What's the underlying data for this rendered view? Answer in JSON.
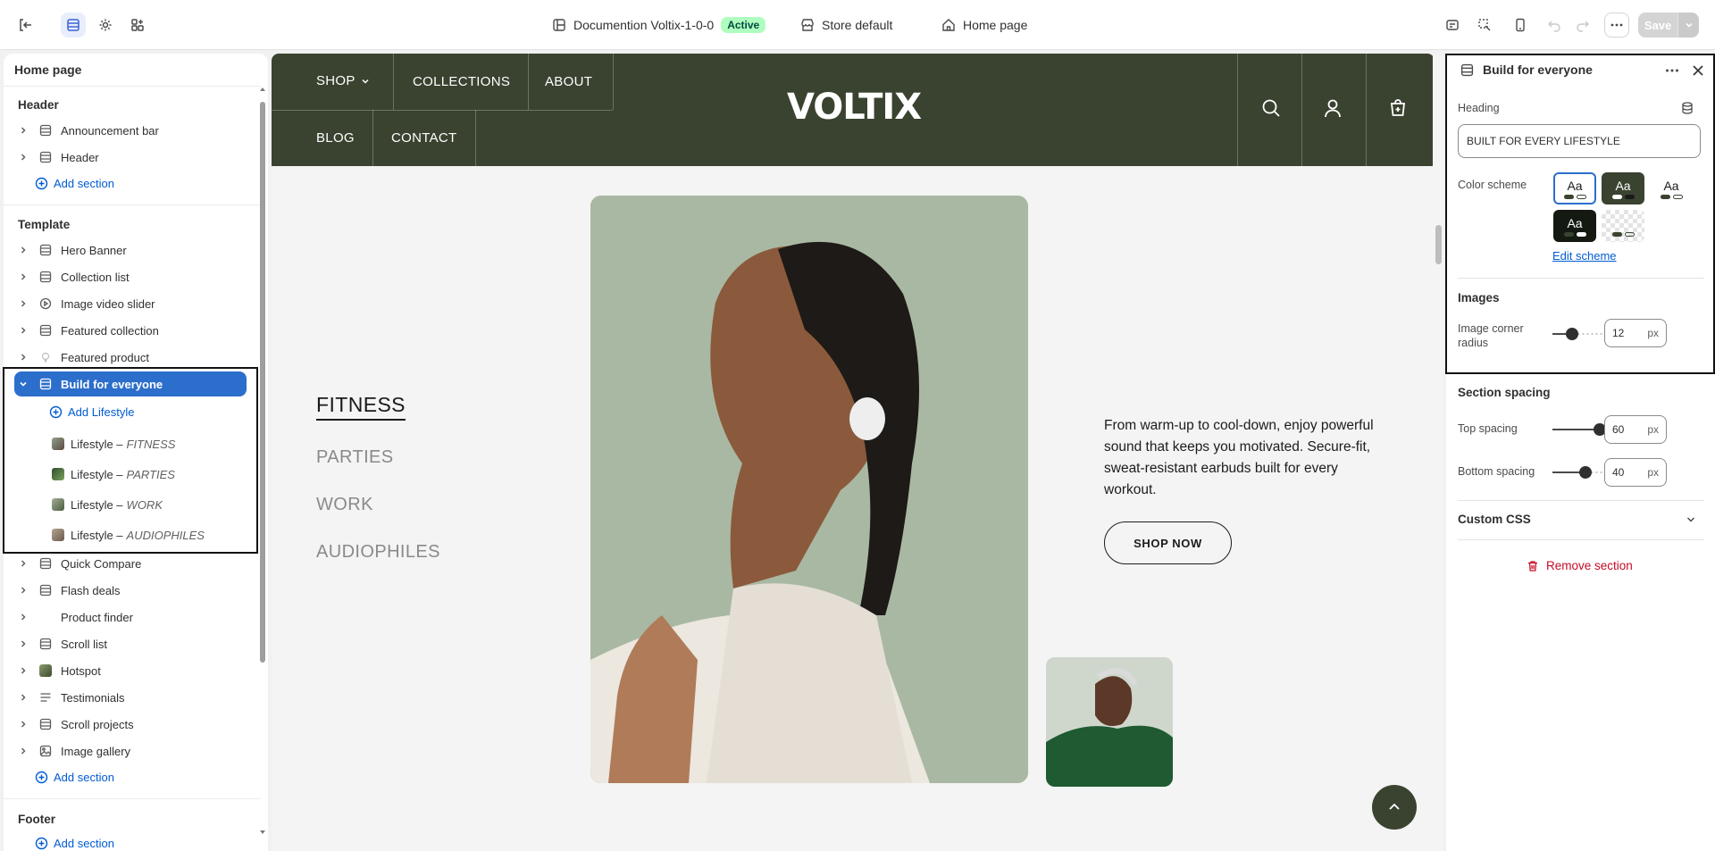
{
  "topbar": {
    "theme_name": "Documention Voltix-1-0-0",
    "status_badge": "Active",
    "store_context": "Store default",
    "page_selector": "Home page",
    "save_label": "Save"
  },
  "left_panel": {
    "title": "Home page",
    "header_group": {
      "label": "Header",
      "items": [
        {
          "label": "Announcement bar"
        },
        {
          "label": "Header"
        }
      ],
      "add_label": "Add section"
    },
    "template_group": {
      "label": "Template",
      "items_before": [
        {
          "label": "Hero Banner",
          "icon": "section-icon"
        },
        {
          "label": "Collection list",
          "icon": "section-icon"
        },
        {
          "label": "Image video slider",
          "icon": "play-icon"
        },
        {
          "label": "Featured collection",
          "icon": "section-icon"
        },
        {
          "label": "Featured product",
          "icon": "bulb-icon"
        }
      ],
      "selected": {
        "label": "Build for everyone",
        "add_block_label": "Add Lifestyle",
        "blocks": [
          {
            "prefix": "Lifestyle – ",
            "name": "FITNESS"
          },
          {
            "prefix": "Lifestyle – ",
            "name": "PARTIES"
          },
          {
            "prefix": "Lifestyle – ",
            "name": "WORK"
          },
          {
            "prefix": "Lifestyle – ",
            "name": "AUDIOPHILES"
          }
        ]
      },
      "items_after": [
        {
          "label": "Quick Compare",
          "icon": "section-icon"
        },
        {
          "label": "Flash deals",
          "icon": "section-icon"
        },
        {
          "label": "Product finder",
          "icon": ""
        },
        {
          "label": "Scroll list",
          "icon": "section-icon"
        },
        {
          "label": "Hotspot",
          "icon": "image-thumb"
        },
        {
          "label": "Testimonials",
          "icon": "list-icon"
        },
        {
          "label": "Scroll projects",
          "icon": "section-icon"
        },
        {
          "label": "Image gallery",
          "icon": "gallery-icon"
        }
      ],
      "add_label": "Add section"
    },
    "footer_group": {
      "label": "Footer",
      "add_label": "Add section"
    }
  },
  "preview": {
    "nav": {
      "shop": "SHOP",
      "collections": "COLLECTIONS",
      "about": "ABOUT",
      "blog": "BLOG",
      "contact": "CONTACT"
    },
    "logo": "VOLTIX",
    "tabs": [
      "FITNESS",
      "PARTIES",
      "WORK",
      "AUDIOPHILES"
    ],
    "description": "From warm-up to cool-down, enjoy powerful sound that keeps you motivated. Secure-fit, sweat-resistant earbuds built for every workout.",
    "cta": "SHOP NOW"
  },
  "right_panel": {
    "title": "Build for everyone",
    "heading_label": "Heading",
    "heading_value": "BUILT FOR EVERY LIFESTYLE",
    "color_scheme_label": "Color scheme",
    "swatch_text": "Aa",
    "edit_scheme": "Edit scheme",
    "images_section": "Images",
    "corner_radius_label": "Image corner radius",
    "corner_radius_value": "12",
    "corner_radius_level": 0.2,
    "unit": "px",
    "spacing_section": "Section spacing",
    "top_spacing_label": "Top spacing",
    "top_spacing_value": "60",
    "top_spacing_level": 0.6,
    "bottom_spacing_label": "Bottom spacing",
    "bottom_spacing_value": "40",
    "bottom_spacing_level": 0.4,
    "custom_css_label": "Custom CSS",
    "remove_label": "Remove section"
  },
  "colors": {
    "brand_dark": "#3a4330",
    "accent_blue": "#2c6ecb",
    "link_blue": "#005bd3",
    "danger": "#c70a24"
  }
}
